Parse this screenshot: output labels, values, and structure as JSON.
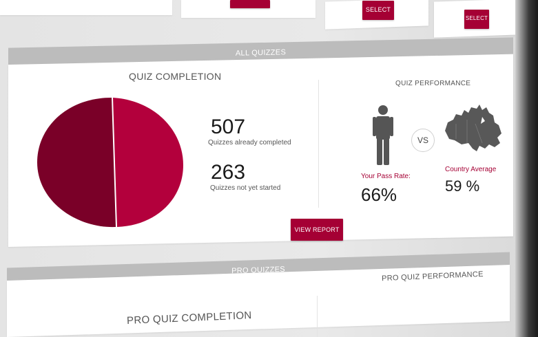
{
  "top_cards": {
    "select_buttons": [
      "SELECT",
      "SELECT"
    ]
  },
  "all_quizzes": {
    "section_label": "ALL QUIZZES",
    "completion": {
      "title": "QUIZ COMPLETION",
      "completed_value": "507",
      "completed_label": "Quizzes already completed",
      "not_started_value": "263",
      "not_started_label": "Quizzes not yet started",
      "pie_colors": [
        "#7a0028",
        "#b3003c"
      ]
    },
    "performance": {
      "title": "QUIZ PERFORMANCE",
      "vs_label": "VS",
      "your_label": "Your Pass Rate:",
      "your_value": "66%",
      "country_label": "Country Average",
      "country_value": "59 %",
      "person_icon": "person-icon",
      "map_icon": "canada-map-icon"
    },
    "view_report_label": "VIEW REPORT"
  },
  "pro_quizzes": {
    "section_label": "PRO QUIZZES",
    "performance_title": "PRO QUIZ PERFORMANCE",
    "completion_title": "PRO QUIZ COMPLETION"
  },
  "colors": {
    "accent": "#a50034",
    "bar_gray": "#bcbcbc"
  }
}
